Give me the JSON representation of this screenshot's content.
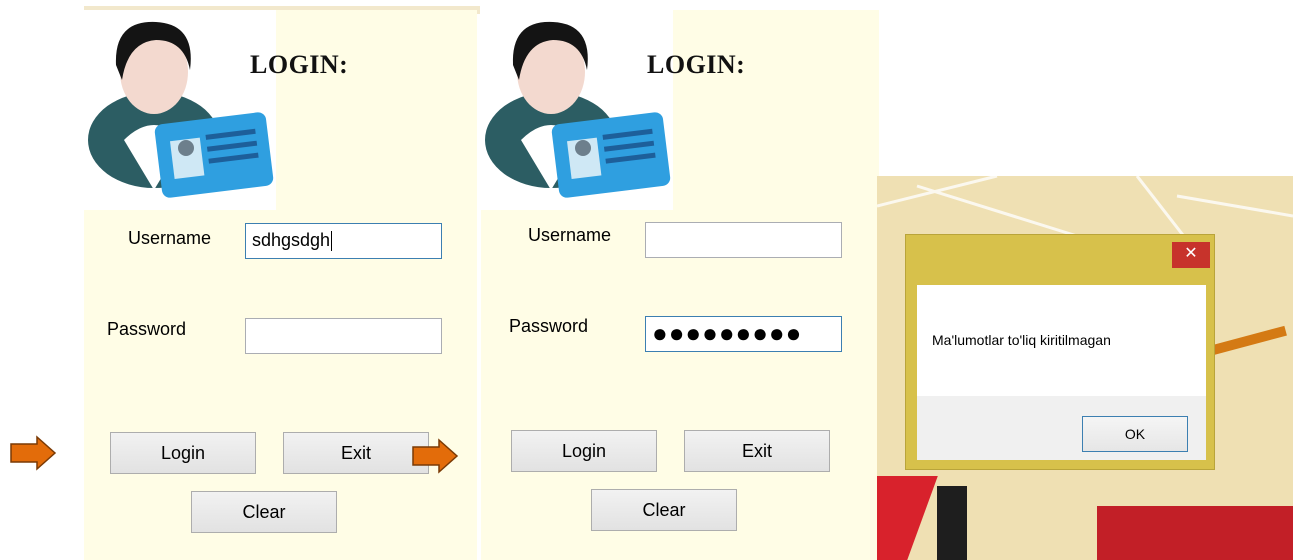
{
  "left_form": {
    "title": "LOGIN:",
    "username_label": "Username",
    "username_value": "sdhgsdgh",
    "password_label": "Password",
    "password_value": "",
    "login_label": "Login",
    "exit_label": "Exit",
    "clear_label": "Clear"
  },
  "right_form": {
    "title": "LOGIN:",
    "username_label": "Username",
    "username_value": "",
    "password_label": "Password",
    "password_masked": "●●●●●●●●●",
    "login_label": "Login",
    "exit_label": "Exit",
    "clear_label": "Clear"
  },
  "dialog": {
    "close_label": "✕",
    "message": "Ma'lumotlar to'liq kiritilmagan",
    "ok_label": "OK"
  },
  "colors": {
    "form_bg": "#fffde6",
    "arrow": "#e36c0a",
    "dialog_frame": "#d7c14b",
    "close_red": "#c7332b"
  },
  "icons": [
    "user-id-card-icon",
    "arrow-right-icon"
  ]
}
